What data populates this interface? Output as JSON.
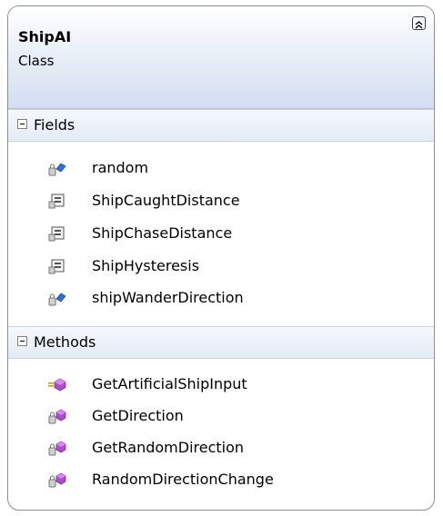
{
  "class": {
    "name": "ShipAI",
    "kind": "Class"
  },
  "fields": {
    "label": "Fields",
    "items": [
      {
        "name": "random",
        "icon": "private-field-icon"
      },
      {
        "name": "ShipCaughtDistance",
        "icon": "constant-icon"
      },
      {
        "name": "ShipChaseDistance",
        "icon": "constant-icon"
      },
      {
        "name": "ShipHysteresis",
        "icon": "constant-icon"
      },
      {
        "name": "shipWanderDirection",
        "icon": "private-field-icon"
      }
    ]
  },
  "methods": {
    "label": "Methods",
    "items": [
      {
        "name": "GetArtificialShipInput",
        "icon": "public-method-icon"
      },
      {
        "name": "GetDirection",
        "icon": "private-method-icon"
      },
      {
        "name": "GetRandomDirection",
        "icon": "private-method-icon"
      },
      {
        "name": "RandomDirectionChange",
        "icon": "private-method-icon"
      }
    ]
  },
  "colors": {
    "field_blue": "#2f6fd6",
    "method_purple": "#b04bd0",
    "header_gradient_end": "#d3def0"
  }
}
